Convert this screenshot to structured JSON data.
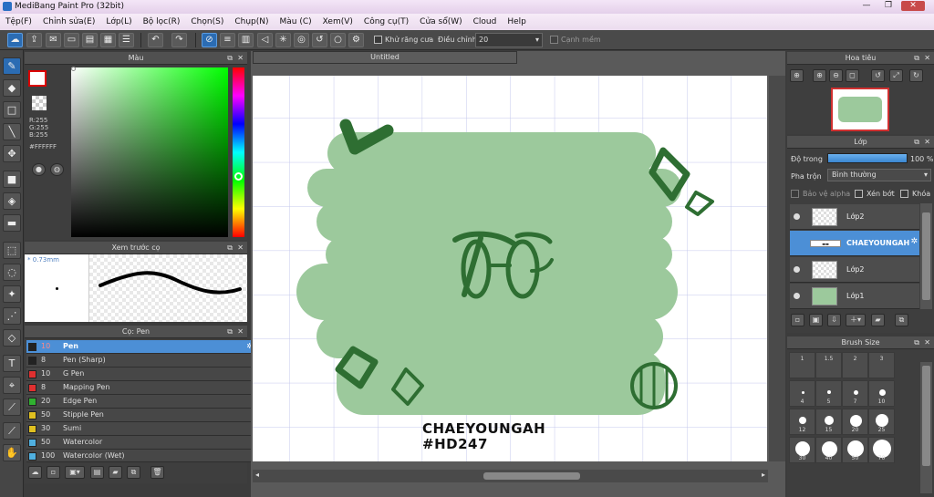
{
  "window": {
    "title": "MediBang Paint Pro (32bit)"
  },
  "menu": [
    "Tệp(F)",
    "Chỉnh sửa(E)",
    "Lớp(L)",
    "Bộ lọc(R)",
    "Chọn(S)",
    "Chụp(N)",
    "Màu (C)",
    "Xem(V)",
    "Công cụ(T)",
    "Cửa sổ(W)",
    "Cloud",
    "Help"
  ],
  "toolbar": {
    "antialias_label": "Khử răng cưa",
    "correction_label": "Điều chỉnh",
    "correction_value": "20",
    "edge_label": "Cạnh mềm"
  },
  "color_panel": {
    "title": "Màu",
    "r": "R:255",
    "g": "G:255",
    "b": "B:255",
    "hex": "#FFFFFF"
  },
  "brush_preview": {
    "title": "Xem trước cọ",
    "size": "0.73mm"
  },
  "brush_panel": {
    "title": "Cọ: Pen",
    "items": [
      {
        "size": "10",
        "name": "Pen",
        "color": "#222222",
        "selected": true
      },
      {
        "size": "8",
        "name": "Pen (Sharp)",
        "color": "#222222"
      },
      {
        "size": "10",
        "name": "G Pen",
        "color": "#e03030"
      },
      {
        "size": "8",
        "name": "Mapping Pen",
        "color": "#e03030"
      },
      {
        "size": "20",
        "name": "Edge Pen",
        "color": "#30b030"
      },
      {
        "size": "50",
        "name": "Stipple Pen",
        "color": "#e0c020"
      },
      {
        "size": "30",
        "name": "Sumi",
        "color": "#e0c020"
      },
      {
        "size": "50",
        "name": "Watercolor",
        "color": "#50b0e0"
      },
      {
        "size": "100",
        "name": "Watercolor (Wet)",
        "color": "#50b0e0"
      }
    ]
  },
  "canvas": {
    "tab": "Untitled",
    "text_line1": "CHAEYOUNGAH",
    "text_line2": "#HD247",
    "accent": "#9cc99c",
    "dark_green": "#2e6e32"
  },
  "navigator": {
    "title": "Hoa tiêu"
  },
  "layers": {
    "title": "Lớp",
    "opacity_label": "Độ trong",
    "opacity_value": "100 %",
    "opacity": 1.0,
    "blend_label": "Pha trộn",
    "blend_value": "Bình thường",
    "protect_alpha": "Bảo vệ alpha",
    "clipping": "Xén bớt",
    "lock": "Khóa",
    "items": [
      {
        "name": "Lớp2"
      },
      {
        "name": "CHAEYOUNGAH",
        "selected": true
      },
      {
        "name": "Lớp2"
      },
      {
        "name": "Lớp1"
      }
    ]
  },
  "brush_size": {
    "title": "Brush Size",
    "sizes": [
      "1",
      "1.5",
      "2",
      "3",
      "4",
      "5",
      "7",
      "10",
      "12",
      "15",
      "20",
      "25",
      "30",
      "40",
      "50",
      "70"
    ]
  }
}
